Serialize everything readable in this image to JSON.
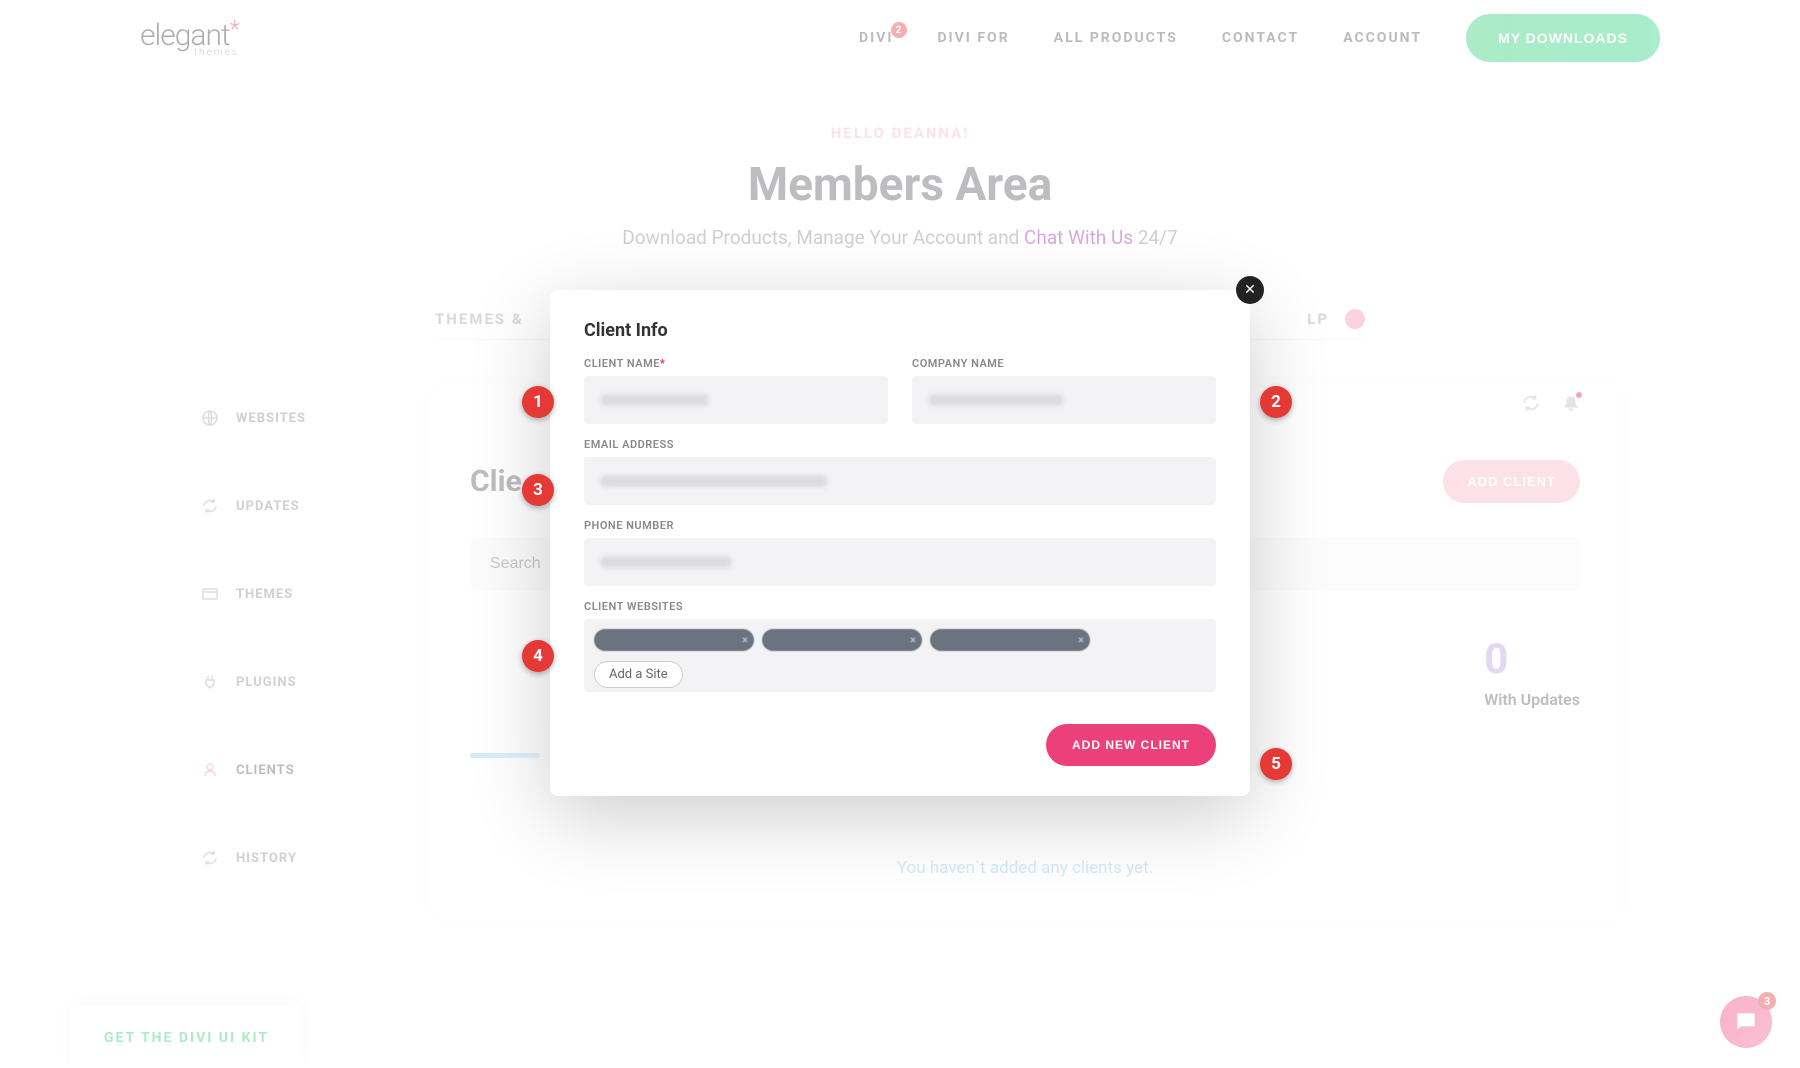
{
  "header": {
    "logo_main": "elegant",
    "logo_sub": "themes",
    "nav": [
      {
        "label": "DIVI",
        "badge": "2"
      },
      {
        "label": "DIVI FOR"
      },
      {
        "label": "ALL PRODUCTS"
      },
      {
        "label": "CONTACT"
      },
      {
        "label": "ACCOUNT"
      }
    ],
    "my_downloads": "MY DOWNLOADS"
  },
  "hero": {
    "hello": "HELLO DEANNA!",
    "title": "Members Area",
    "subtitle_pre": "Download Products, Manage Your Account and ",
    "subtitle_link": "Chat With Us",
    "subtitle_post": " 24/7"
  },
  "tabs": {
    "left": "THEMES &",
    "right": "LP"
  },
  "sidebar": [
    {
      "icon": "globe",
      "label": "WEBSITES"
    },
    {
      "icon": "refresh",
      "label": "UPDATES"
    },
    {
      "icon": "card",
      "label": "THEMES"
    },
    {
      "icon": "plug",
      "label": "PLUGINS"
    },
    {
      "icon": "user",
      "label": "CLIENTS",
      "active": true
    },
    {
      "icon": "refresh",
      "label": "HISTORY"
    }
  ],
  "panel": {
    "title_partial": "Clie",
    "add_client": "ADD CLIENT",
    "search_placeholder": "Search",
    "stat_num": "0",
    "stat_label": "With Updates",
    "empty": "You haven`t added any clients yet."
  },
  "modal": {
    "title": "Client Info",
    "labels": {
      "client_name": "CLIENT NAME",
      "company_name": "COMPANY NAME",
      "email": "EMAIL ADDRESS",
      "phone": "PHONE NUMBER",
      "websites": "CLIENT WEBSITES"
    },
    "add_site": "Add a Site",
    "submit": "ADD NEW CLIENT"
  },
  "annotations": [
    "1",
    "2",
    "3",
    "4",
    "5"
  ],
  "promo": "GET THE DIVI UI KIT",
  "chat_badge": "3"
}
